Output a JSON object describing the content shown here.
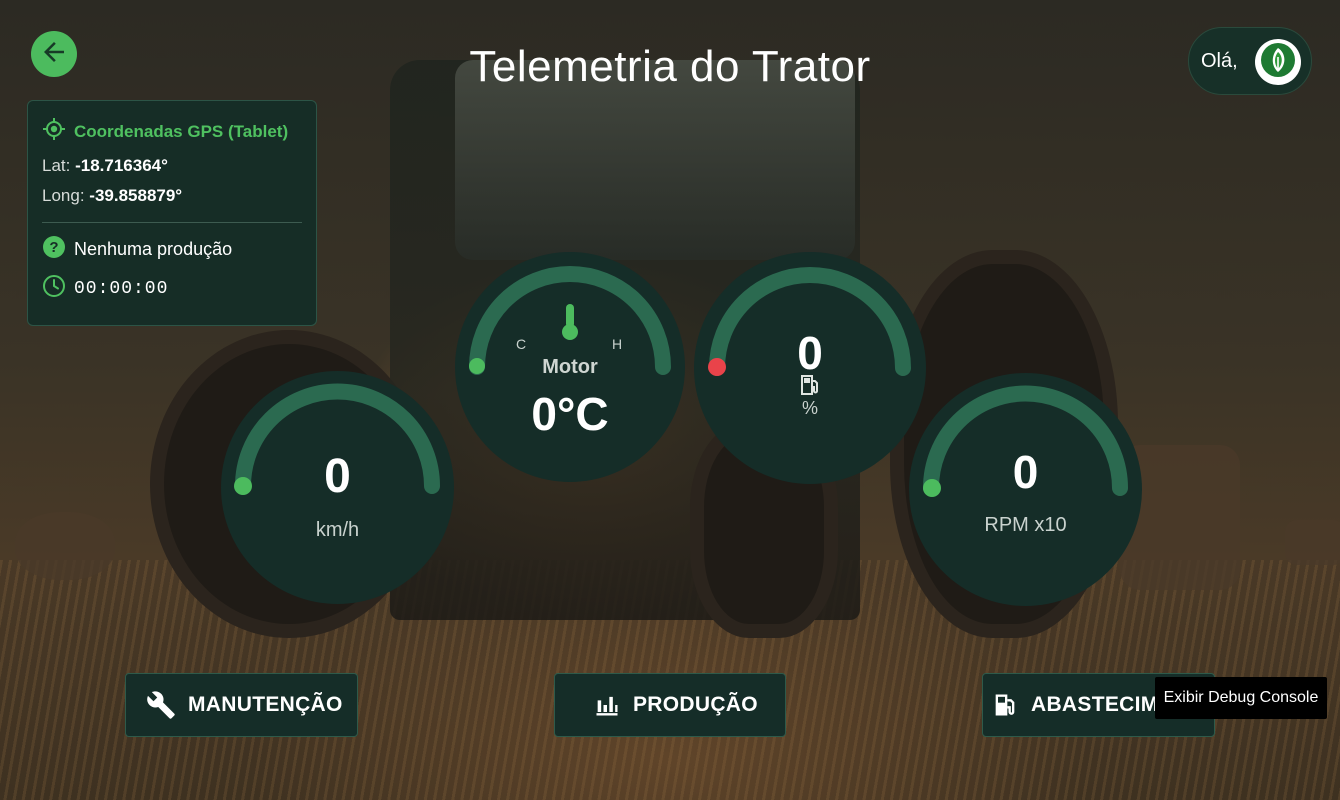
{
  "header": {
    "title": "Telemetria do Trator",
    "greeting": "Olá,"
  },
  "gps": {
    "title": "Coordenadas GPS (Tablet)",
    "lat_label": "Lat:",
    "lat_value": "-18.716364°",
    "long_label": "Long:",
    "long_value": "-39.858879°",
    "production_status": "Nenhuma produção",
    "timer": "00:00:00"
  },
  "gauges": {
    "speed": {
      "value": "0",
      "unit": "km/h",
      "level": 0
    },
    "motor": {
      "cold_label": "C",
      "hot_label": "H",
      "label": "Motor",
      "value": "0°C",
      "level": 0
    },
    "fuel": {
      "value": "0",
      "unit": "%",
      "level": 0
    },
    "rpm": {
      "value": "0",
      "unit": "RPM x10",
      "level": 0
    }
  },
  "actions": {
    "maintenance_label": "MANUTENÇÃO",
    "production_label": "PRODUÇÃO",
    "fueling_label": "ABASTECIMENTO"
  },
  "tooltip": {
    "text": "Exibir Debug Console"
  },
  "colors": {
    "accent": "#4cbb5e",
    "gauge_bg": "#152d28",
    "gauge_track": "#2b6a50",
    "alert": "#e9434a"
  },
  "icons": {
    "back": "arrow-left-icon",
    "gps": "gps-target-icon",
    "help": "help-circle-icon",
    "clock": "clock-icon",
    "thermometer": "thermometer-icon",
    "fuel": "fuel-pump-icon",
    "wrench": "wrench-icon",
    "chart": "bar-chart-icon",
    "logo": "leaf-logo-icon"
  }
}
